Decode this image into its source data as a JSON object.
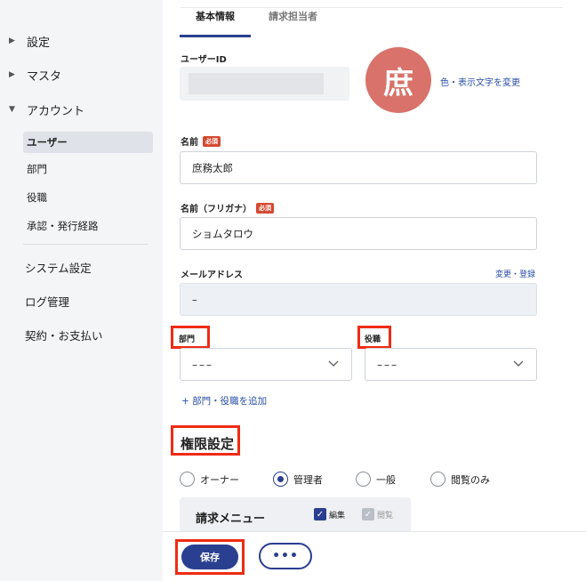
{
  "sidebar": {
    "groups": [
      {
        "caret": "▶",
        "label": "設定"
      },
      {
        "caret": "▶",
        "label": "マスタ"
      },
      {
        "caret": "▼",
        "label": "アカウント"
      }
    ],
    "sub_items": [
      {
        "label": "ユーザー",
        "active": true
      },
      {
        "label": "部門"
      },
      {
        "label": "役職"
      },
      {
        "label": "承認・発行経路"
      }
    ],
    "main_items": [
      {
        "label": "システム設定"
      },
      {
        "label": "ログ管理"
      },
      {
        "label": "契約・お支払い"
      }
    ]
  },
  "tabs": [
    {
      "label": "基本情報",
      "active": true
    },
    {
      "label": "請求担当者",
      "active": false
    }
  ],
  "user_id": {
    "label": "ユーザーID"
  },
  "avatar": {
    "char": "庶",
    "change_link": "色・表示文字を変更",
    "color": "#d9726a"
  },
  "required_badge": "必須",
  "name": {
    "label": "名前",
    "value": "庶務太郎"
  },
  "name_kana": {
    "label": "名前（フリガナ）",
    "value": "ショムタロウ"
  },
  "email": {
    "label": "メールアドレス",
    "value": "–",
    "link": "変更・登録"
  },
  "department": {
    "label": "部門",
    "value": "–––"
  },
  "position": {
    "label": "役職",
    "value": "–––"
  },
  "add_link": "+ 部門・役職を追加",
  "permissions": {
    "title": "権限設定",
    "options": [
      {
        "label": "オーナー",
        "selected": false
      },
      {
        "label": "管理者",
        "selected": true
      },
      {
        "label": "一般",
        "selected": false
      },
      {
        "label": "閲覧のみ",
        "selected": false
      }
    ],
    "card": {
      "title": "請求メニュー",
      "checks": [
        {
          "label": "編集",
          "checked": true
        },
        {
          "label": "閲覧",
          "checked": true,
          "disabled": true
        }
      ]
    }
  },
  "footer": {
    "save_label": "保存",
    "more_label": "•••"
  },
  "colors": {
    "primary": "#2a3f8f",
    "highlight": "#ef2b14",
    "required": "#d34a31"
  }
}
